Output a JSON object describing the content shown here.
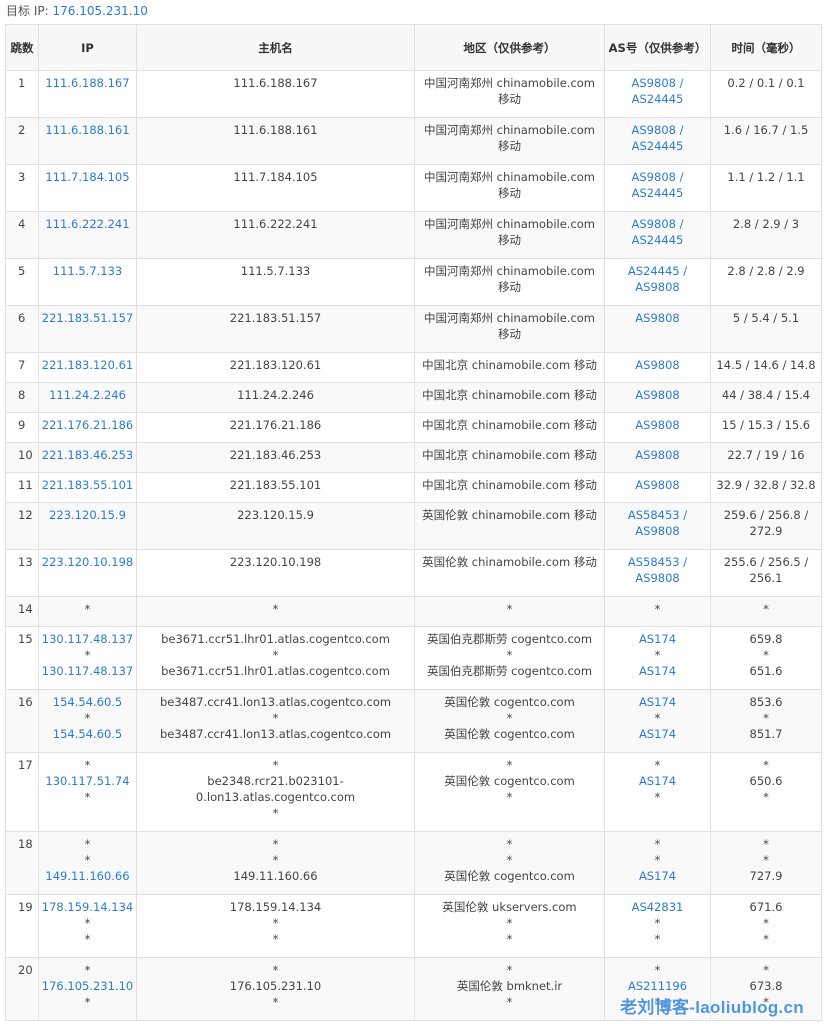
{
  "target": {
    "label": "目标 IP:",
    "ip": "176.105.231.10"
  },
  "headers": [
    "跳数",
    "IP",
    "主机名",
    "地区（仅供参考）",
    "AS号（仅供参考）",
    "时间（毫秒）"
  ],
  "rows": [
    {
      "hop": "1",
      "ip": [
        "111.6.188.167"
      ],
      "host": [
        "111.6.188.167"
      ],
      "region": [
        "中国河南郑州 chinamobile.com 移动"
      ],
      "as": [
        "AS9808 /",
        "AS24445"
      ],
      "time": [
        "0.2 / 0.1 / 0.1"
      ],
      "h": 47
    },
    {
      "hop": "2",
      "ip": [
        "111.6.188.161"
      ],
      "host": [
        "111.6.188.161"
      ],
      "region": [
        "中国河南郑州 chinamobile.com 移动"
      ],
      "as": [
        "AS9808 /",
        "AS24445"
      ],
      "time": [
        "1.6 / 16.7 / 1.5"
      ],
      "h": 47
    },
    {
      "hop": "3",
      "ip": [
        "111.7.184.105"
      ],
      "host": [
        "111.7.184.105"
      ],
      "region": [
        "中国河南郑州 chinamobile.com 移动"
      ],
      "as": [
        "AS9808 /",
        "AS24445"
      ],
      "time": [
        "1.1 / 1.2 / 1.1"
      ],
      "h": 47
    },
    {
      "hop": "4",
      "ip": [
        "111.6.222.241"
      ],
      "host": [
        "111.6.222.241"
      ],
      "region": [
        "中国河南郑州 chinamobile.com 移动"
      ],
      "as": [
        "AS9808 /",
        "AS24445"
      ],
      "time": [
        "2.8 / 2.9 / 3"
      ],
      "h": 47
    },
    {
      "hop": "5",
      "ip": [
        "111.5.7.133"
      ],
      "host": [
        "111.5.7.133"
      ],
      "region": [
        "中国河南郑州 chinamobile.com 移动"
      ],
      "as": [
        "AS24445 /",
        "AS9808"
      ],
      "time": [
        "2.8 / 2.8 / 2.9"
      ],
      "h": 47
    },
    {
      "hop": "6",
      "ip": [
        "221.183.51.157"
      ],
      "host": [
        "221.183.51.157"
      ],
      "region": [
        "中国河南郑州 chinamobile.com 移动"
      ],
      "as": [
        "AS9808"
      ],
      "time": [
        "5 / 5.4 / 5.1"
      ],
      "h": 47
    },
    {
      "hop": "7",
      "ip": [
        "221.183.120.61"
      ],
      "host": [
        "221.183.120.61"
      ],
      "region": [
        "中国北京 chinamobile.com 移动"
      ],
      "as": [
        "AS9808"
      ],
      "time": [
        "14.5 / 14.6 / 14.8"
      ],
      "h": 30
    },
    {
      "hop": "8",
      "ip": [
        "111.24.2.246"
      ],
      "host": [
        "111.24.2.246"
      ],
      "region": [
        "中国北京 chinamobile.com 移动"
      ],
      "as": [
        "AS9808"
      ],
      "time": [
        "44 / 38.4 / 15.4"
      ],
      "h": 30
    },
    {
      "hop": "9",
      "ip": [
        "221.176.21.186"
      ],
      "host": [
        "221.176.21.186"
      ],
      "region": [
        "中国北京 chinamobile.com 移动"
      ],
      "as": [
        "AS9808"
      ],
      "time": [
        "15 / 15.3 / 15.6"
      ],
      "h": 30
    },
    {
      "hop": "10",
      "ip": [
        "221.183.46.253"
      ],
      "host": [
        "221.183.46.253"
      ],
      "region": [
        "中国北京 chinamobile.com 移动"
      ],
      "as": [
        "AS9808"
      ],
      "time": [
        "22.7 / 19 / 16"
      ],
      "h": 30
    },
    {
      "hop": "11",
      "ip": [
        "221.183.55.101"
      ],
      "host": [
        "221.183.55.101"
      ],
      "region": [
        "中国北京 chinamobile.com 移动"
      ],
      "as": [
        "AS9808"
      ],
      "time": [
        "32.9 / 32.8 / 32.8"
      ],
      "h": 30
    },
    {
      "hop": "12",
      "ip": [
        "223.120.15.9"
      ],
      "host": [
        "223.120.15.9"
      ],
      "region": [
        "英国伦敦 chinamobile.com 移动"
      ],
      "as": [
        "AS58453 /",
        "AS9808"
      ],
      "time": [
        "259.6 / 256.8 /",
        "272.9"
      ],
      "h": 47
    },
    {
      "hop": "13",
      "ip": [
        "223.120.10.198"
      ],
      "host": [
        "223.120.10.198"
      ],
      "region": [
        "英国伦敦 chinamobile.com 移动"
      ],
      "as": [
        "AS58453 /",
        "AS9808"
      ],
      "time": [
        "255.6 / 256.5 /",
        "256.1"
      ],
      "h": 47
    },
    {
      "hop": "14",
      "ip": [
        "*"
      ],
      "host": [
        "*"
      ],
      "region": [
        "*"
      ],
      "as": [
        "*"
      ],
      "time": [
        "*"
      ],
      "h": 30
    },
    {
      "hop": "15",
      "ip": [
        "130.117.48.137",
        "*",
        "130.117.48.137"
      ],
      "host": [
        "be3671.ccr51.lhr01.atlas.cogentco.com",
        "*",
        "be3671.ccr51.lhr01.atlas.cogentco.com"
      ],
      "region": [
        "英国伯克郡斯劳 cogentco.com",
        "*",
        "英国伯克郡斯劳 cogentco.com"
      ],
      "as": [
        "AS174",
        "*",
        "AS174"
      ],
      "time": [
        "659.8",
        "*",
        "651.6"
      ],
      "h": 63
    },
    {
      "hop": "16",
      "ip": [
        "154.54.60.5",
        "*",
        "154.54.60.5"
      ],
      "host": [
        "be3487.ccr41.lon13.atlas.cogentco.com",
        "*",
        "be3487.ccr41.lon13.atlas.cogentco.com"
      ],
      "region": [
        "英国伦敦 cogentco.com",
        "*",
        "英国伦敦 cogentco.com"
      ],
      "as": [
        "AS174",
        "*",
        "AS174"
      ],
      "time": [
        "853.6",
        "*",
        "851.7"
      ],
      "h": 63
    },
    {
      "hop": "17",
      "ip": [
        "*",
        "130.117.51.74",
        "*"
      ],
      "host": [
        "*",
        "be2348.rcr21.b023101-",
        "0.lon13.atlas.cogentco.com",
        "*"
      ],
      "region": [
        "*",
        "英国伦敦 cogentco.com",
        "*"
      ],
      "as": [
        "*",
        "AS174",
        "*"
      ],
      "time": [
        "*",
        "650.6",
        "*"
      ],
      "h": 79
    },
    {
      "hop": "18",
      "ip": [
        "*",
        "*",
        "149.11.160.66"
      ],
      "host": [
        "*",
        "*",
        "149.11.160.66"
      ],
      "region": [
        "*",
        "*",
        "英国伦敦 cogentco.com"
      ],
      "as": [
        "*",
        "*",
        "AS174"
      ],
      "time": [
        "*",
        "*",
        "727.9"
      ],
      "h": 63
    },
    {
      "hop": "19",
      "ip": [
        "178.159.14.134",
        "*",
        "*"
      ],
      "host": [
        "178.159.14.134",
        "*",
        "*"
      ],
      "region": [
        "英国伦敦 ukservers.com",
        "*",
        "*"
      ],
      "as": [
        "AS42831",
        "*",
        "*"
      ],
      "time": [
        "671.6",
        "*",
        "*"
      ],
      "h": 63
    },
    {
      "hop": "20",
      "ip": [
        "*",
        "176.105.231.10",
        "*"
      ],
      "host": [
        "*",
        "176.105.231.10",
        "*"
      ],
      "region": [
        "*",
        "英国伦敦 bmknet.ir",
        "*"
      ],
      "as": [
        "*",
        "AS211196",
        "*"
      ],
      "time": [
        "*",
        "673.8",
        "*"
      ],
      "h": 63
    }
  ],
  "watermark": "老刘博客-laoliublog.cn"
}
